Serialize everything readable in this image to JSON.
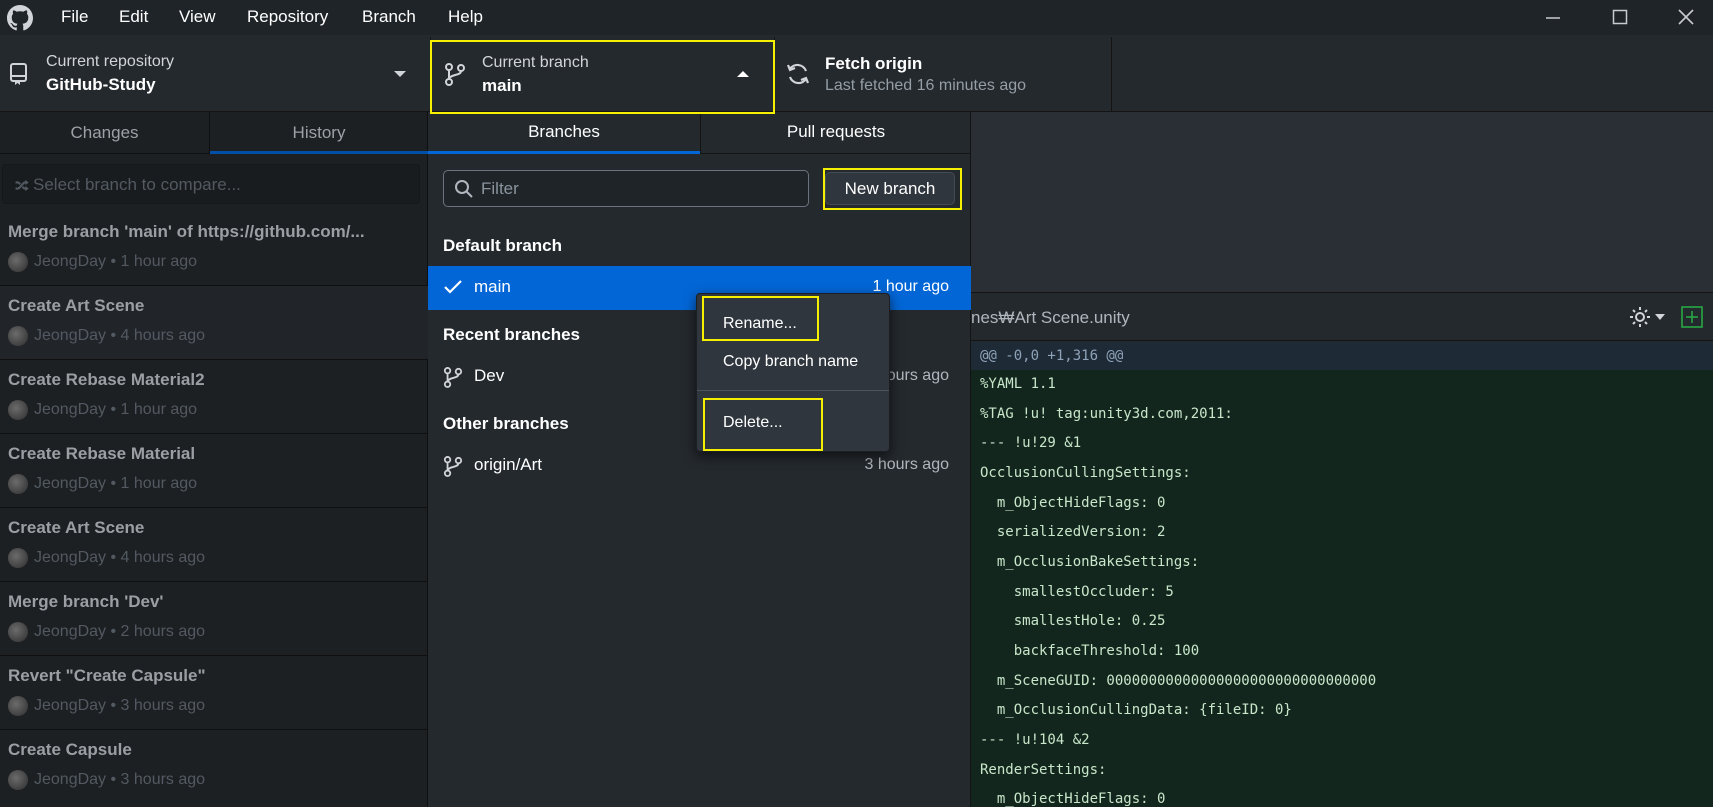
{
  "menubar": {
    "items": [
      "File",
      "Edit",
      "View",
      "Repository",
      "Branch",
      "Help"
    ]
  },
  "toolbar": {
    "repo_label": "Current repository",
    "repo_name": "GitHub-Study",
    "branch_label": "Current branch",
    "branch_name": "main",
    "fetch_title": "Fetch origin",
    "fetch_sub": "Last fetched 16 minutes ago"
  },
  "left": {
    "tabs": [
      "Changes",
      "History"
    ],
    "compare_placeholder": "Select branch to compare...",
    "commits": [
      {
        "title": "Merge branch 'main' of https://github.com/...",
        "author": "JeongDay",
        "time": "1 hour ago"
      },
      {
        "title": "Create Art Scene",
        "author": "JeongDay",
        "time": "4 hours ago"
      },
      {
        "title": "Create Rebase Material2",
        "author": "JeongDay",
        "time": "1 hour ago"
      },
      {
        "title": "Create Rebase Material",
        "author": "JeongDay",
        "time": "1 hour ago"
      },
      {
        "title": "Create Art Scene",
        "author": "JeongDay",
        "time": "4 hours ago"
      },
      {
        "title": "Merge branch 'Dev'",
        "author": "JeongDay",
        "time": "2 hours ago"
      },
      {
        "title": "Revert \"Create Capsule\"",
        "author": "JeongDay",
        "time": "3 hours ago"
      },
      {
        "title": "Create Capsule",
        "author": "JeongDay",
        "time": "3 hours ago"
      }
    ]
  },
  "branches": {
    "tabs": [
      "Branches",
      "Pull requests"
    ],
    "filter_placeholder": "Filter",
    "new_branch_label": "New branch",
    "default_header": "Default branch",
    "recent_header": "Recent branches",
    "other_header": "Other branches",
    "default": {
      "name": "main",
      "time": "1 hour ago"
    },
    "recent": {
      "name": "Dev",
      "time": "hours ago"
    },
    "other": {
      "name": "origin/Art",
      "time": "3 hours ago"
    }
  },
  "context_menu": {
    "items": [
      "Rename...",
      "Copy branch name",
      "Delete..."
    ]
  },
  "diff": {
    "file_path": "nes₩Art Scene.unity",
    "hunk": "@@ -0,0 +1,316 @@",
    "lines": [
      "%YAML 1.1",
      "%TAG !u! tag:unity3d.com,2011:",
      "--- !u!29 &1",
      "OcclusionCullingSettings:",
      "  m_ObjectHideFlags: 0",
      "  serializedVersion: 2",
      "  m_OcclusionBakeSettings:",
      "    smallestOccluder: 5",
      "    smallestHole: 0.25",
      "    backfaceThreshold: 100",
      "  m_SceneGUID: 00000000000000000000000000000000",
      "  m_OcclusionCullingData: {fileID: 0}",
      "--- !u!104 &2",
      "RenderSettings:",
      "  m_ObjectHideFlags: 0"
    ]
  },
  "colors": {
    "accent": "#0366d6",
    "highlight": "#f5f000",
    "diff_added_bg": "#12261e"
  }
}
